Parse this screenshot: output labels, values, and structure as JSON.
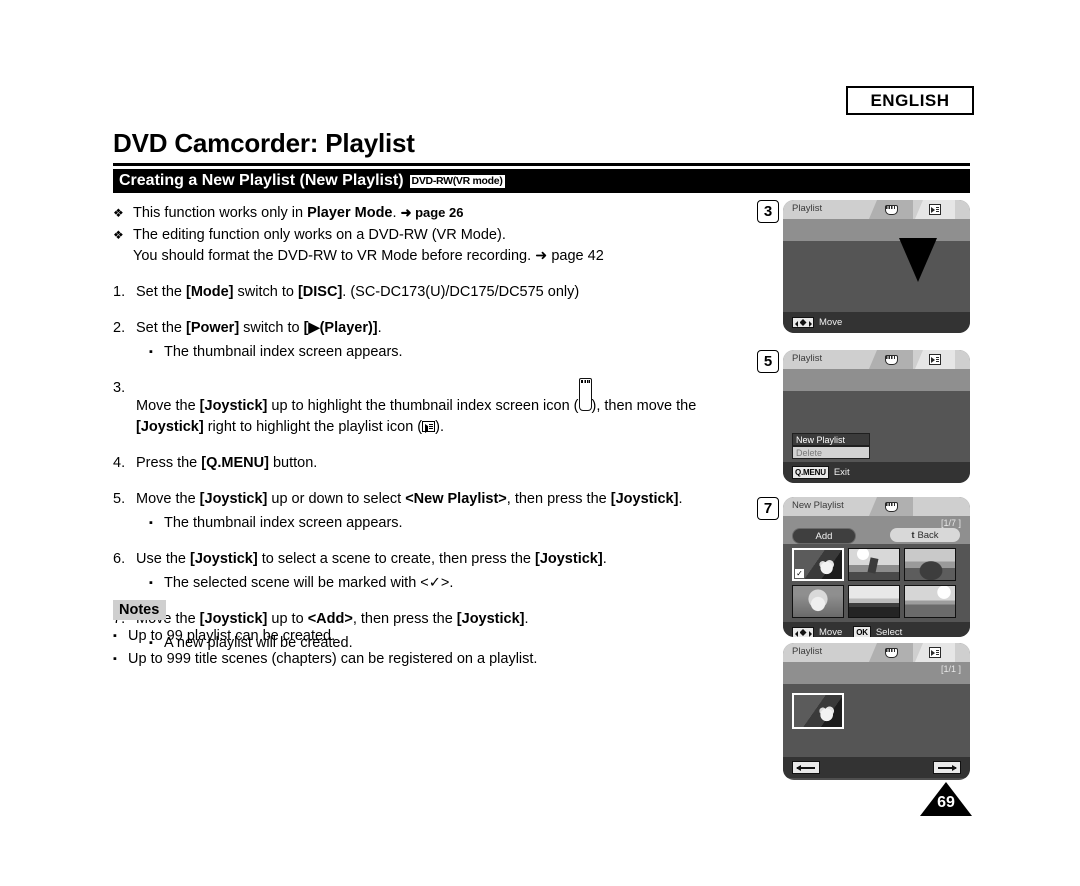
{
  "header": {
    "language_badge": "ENGLISH",
    "page_title": "DVD Camcorder: Playlist",
    "section_title": "Creating a New Playlist (New Playlist)",
    "mode_badge": "DVD-RW(VR mode)"
  },
  "prereqs": [
    {
      "mark": "❖",
      "lead": "This function works only in ",
      "bold": "Player Mode",
      "tail": ". ",
      "ref": "➜ page 26",
      "line2": ""
    },
    {
      "mark": "❖",
      "lead": "The editing function only works on a DVD-RW (VR Mode).",
      "bold": "",
      "tail": "",
      "ref": "",
      "line2": "You should format the DVD-RW to VR Mode before recording. ➜ page 42"
    }
  ],
  "steps": [
    {
      "num": "1.",
      "parts": [
        {
          "t": "Set the ",
          "b": false
        },
        {
          "t": "[Mode]",
          "b": true
        },
        {
          "t": " switch to ",
          "b": false
        },
        {
          "t": "[DISC]",
          "b": true
        },
        {
          "t": ". (SC-DC173(U)/DC175/DC575 only)",
          "b": false
        }
      ],
      "subs": []
    },
    {
      "num": "2.",
      "parts": [
        {
          "t": "Set the ",
          "b": false
        },
        {
          "t": "[Power]",
          "b": true
        },
        {
          "t": " switch to ",
          "b": false
        },
        {
          "t": "[▶(Player)]",
          "b": true
        },
        {
          "t": ".",
          "b": false
        }
      ],
      "subs": [
        "The thumbnail index screen appears."
      ]
    },
    {
      "num": "3.",
      "parts": [
        {
          "t": "Move the ",
          "b": false
        },
        {
          "t": "[Joystick]",
          "b": true
        },
        {
          "t": " up to highlight the thumbnail index screen icon (",
          "b": false
        },
        {
          "t": "ICON_THUMB",
          "b": false
        },
        {
          "t": "), then move the ",
          "b": false
        },
        {
          "t": "[Joystick]",
          "b": true
        },
        {
          "t": " right to highlight the playlist icon (",
          "b": false
        },
        {
          "t": "ICON_PLAYLIST",
          "b": false
        },
        {
          "t": ").",
          "b": false
        }
      ],
      "subs": []
    },
    {
      "num": "4.",
      "parts": [
        {
          "t": "Press the ",
          "b": false
        },
        {
          "t": "[Q.MENU]",
          "b": true
        },
        {
          "t": " button.",
          "b": false
        }
      ],
      "subs": []
    },
    {
      "num": "5.",
      "parts": [
        {
          "t": "Move the ",
          "b": false
        },
        {
          "t": "[Joystick]",
          "b": true
        },
        {
          "t": " up or down to select ",
          "b": false
        },
        {
          "t": "<New Playlist>",
          "b": true
        },
        {
          "t": ", then press the ",
          "b": false
        },
        {
          "t": "[Joystick]",
          "b": true
        },
        {
          "t": ".",
          "b": false
        }
      ],
      "subs": [
        "The thumbnail index screen appears."
      ]
    },
    {
      "num": "6.",
      "parts": [
        {
          "t": "Use the ",
          "b": false
        },
        {
          "t": "[Joystick]",
          "b": true
        },
        {
          "t": " to select a scene to create, then press the ",
          "b": false
        },
        {
          "t": "[Joystick]",
          "b": true
        },
        {
          "t": ".",
          "b": false
        }
      ],
      "subs": [
        "The selected scene will be marked with <✓>."
      ]
    },
    {
      "num": "7.",
      "parts": [
        {
          "t": "Move the ",
          "b": false
        },
        {
          "t": "[Joystick]",
          "b": true
        },
        {
          "t": " up to ",
          "b": false
        },
        {
          "t": "<Add>",
          "b": true
        },
        {
          "t": ", then press the ",
          "b": false
        },
        {
          "t": "[Joystick]",
          "b": true
        },
        {
          "t": ".",
          "b": false
        }
      ],
      "subs": [
        "A new playlist will be created."
      ]
    }
  ],
  "notes": {
    "label": "Notes",
    "items": [
      "Up to 99 playlist can be created.",
      "Up to 999 title scenes (chapters) can be registered on a playlist."
    ]
  },
  "screens": {
    "panel3": {
      "badge": "3",
      "title": "Playlist",
      "tab1_icon": "thumbnail-index-icon",
      "tab2_icon": "playlist-icon",
      "footer_key": "joystick-key",
      "footer_label": "Move"
    },
    "panel5": {
      "badge": "5",
      "title": "Playlist",
      "tab1_icon": "thumbnail-index-icon",
      "tab2_icon": "playlist-icon",
      "menu": [
        {
          "label": "New Playlist",
          "selected": true
        },
        {
          "label": "Delete",
          "selected": false
        }
      ],
      "footer_key": "Q.MENU",
      "footer_label": "Exit"
    },
    "panel7": {
      "badge": "7",
      "title": "New Playlist",
      "tab1_icon": "thumbnail-index-icon",
      "counter": "[1/7 ]",
      "add_label": "Add",
      "back_label": "Back",
      "back_glyph": "t",
      "thumbnails": [
        {
          "name": "lotus-flower",
          "selected": true,
          "check": "✓"
        },
        {
          "name": "person-with-ball",
          "selected": false,
          "check": ""
        },
        {
          "name": "dolphin",
          "selected": false,
          "check": ""
        },
        {
          "name": "dog",
          "selected": false,
          "check": ""
        },
        {
          "name": "lake-sunset",
          "selected": false,
          "check": ""
        },
        {
          "name": "field-landscape",
          "selected": false,
          "check": ""
        }
      ],
      "footer_move_label": "Move",
      "footer_ok_key": "OK",
      "footer_ok_label": "Select"
    },
    "panel8": {
      "title": "Playlist",
      "tab1_icon": "thumbnail-index-icon",
      "tab2_icon": "playlist-icon",
      "counter": "[1/1 ]",
      "thumbnails": [
        {
          "name": "lotus-flower",
          "selected": true
        }
      ],
      "nav_prev_icon": "arrow-left-icon",
      "nav_next_icon": "arrow-right-icon"
    }
  },
  "page_number": "69"
}
